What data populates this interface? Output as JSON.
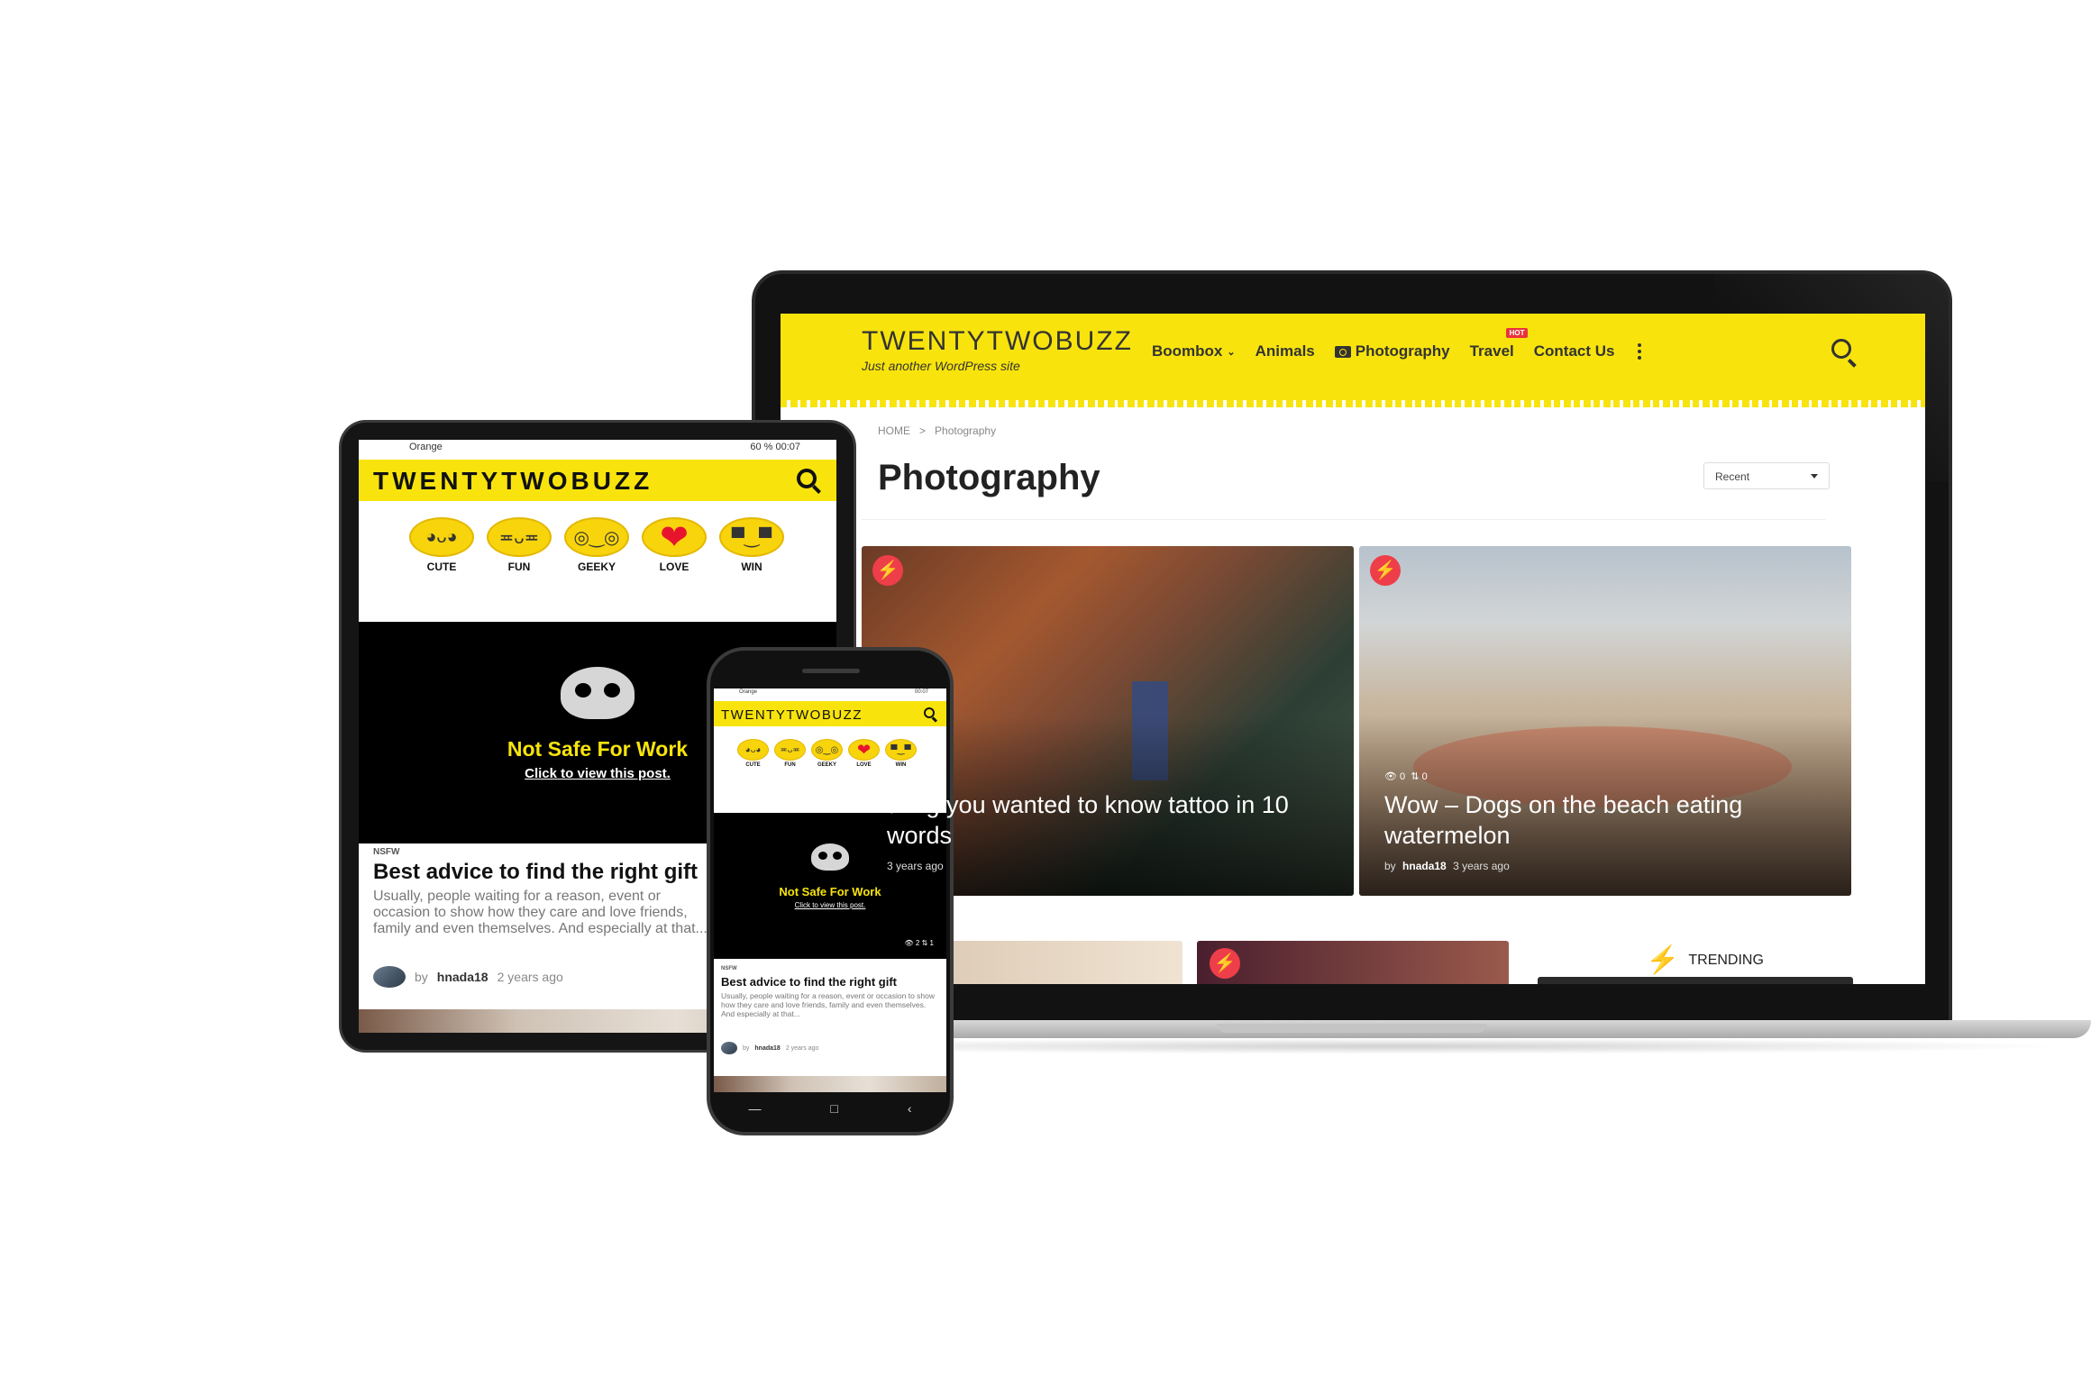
{
  "laptop": {
    "site_title": "TWENTYTWOBUZZ",
    "tagline": "Just another WordPress site",
    "nav": {
      "boombox": "Boombox",
      "animals": "Animals",
      "photography": "Photography",
      "travel": "Travel",
      "travel_badge": "HOT",
      "contact": "Contact Us"
    },
    "breadcrumb": {
      "home": "HOME",
      "sep": ">",
      "current": "Photography"
    },
    "page_title": "Photography",
    "sort_select": "Recent",
    "cards": [
      {
        "title": "thing you wanted to know tattoo in 10 words",
        "time": "3 years ago"
      },
      {
        "title": "Wow – Dogs on the beach eating watermelon",
        "views": "0",
        "shares": "0",
        "by": "by",
        "author": "hnada18",
        "time": "3 years ago"
      }
    ],
    "trending_label": "TRENDING"
  },
  "tablet": {
    "status": {
      "carrier": "Orange",
      "battery": "60 %",
      "time": "00:07"
    },
    "site_title": "TWENTYTWOBUZZ",
    "reactions": [
      "CUTE",
      "FUN",
      "GEEKY",
      "LOVE",
      "WIN"
    ],
    "nsfw_title": "Not Safe For Work",
    "nsfw_link": "Click to view this post.",
    "post": {
      "category": "NSFW",
      "title": "Best advice to find the right gift",
      "excerpt": "Usually,  people waiting for a reason, event or occasion to show how they care  and love friends, family and even themselves. And especially at that...",
      "by": "by",
      "author": "hnada18",
      "time": "2 years ago"
    }
  },
  "phone": {
    "status": {
      "carrier": "Orange",
      "time": "00:07"
    },
    "site_title": "TWENTYTWOBUZZ",
    "reactions": [
      "CUTE",
      "FUN",
      "GEEKY",
      "LOVE",
      "WIN"
    ],
    "nsfw_title": "Not Safe For Work",
    "nsfw_link": "Click to view this post.",
    "stats": {
      "views": "2",
      "shares": "1"
    },
    "post": {
      "category": "NSFW",
      "title": "Best advice to find the right gift",
      "excerpt": "Usually,  people waiting for a reason, event or occasion to show how they care  and love friends, family and even themselves. And especially at that...",
      "by": "by",
      "author": "hnada18",
      "time": "2 years ago"
    }
  },
  "colors": {
    "brand_yellow": "#f8e40c",
    "accent_red": "#ee3e4a",
    "nsfw_background": "#000000"
  },
  "icons": [
    "search-icon",
    "camera-icon",
    "chevron-down-icon",
    "more-vertical-icon",
    "lightning-icon",
    "skull-icon",
    "eye-icon",
    "share-icon"
  ]
}
